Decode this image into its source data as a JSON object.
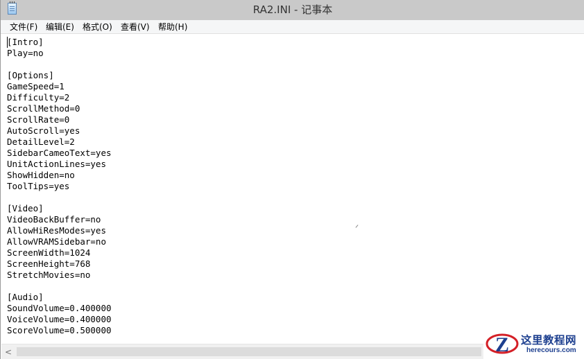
{
  "window": {
    "title": "RA2.INI - 记事本"
  },
  "menubar": {
    "items": [
      {
        "label": "文件(F)"
      },
      {
        "label": "编辑(E)"
      },
      {
        "label": "格式(O)"
      },
      {
        "label": "查看(V)"
      },
      {
        "label": "帮助(H)"
      }
    ]
  },
  "editor": {
    "content": "[Intro]\nPlay=no\n\n[Options]\nGameSpeed=1\nDifficulty=2\nScrollMethod=0\nScrollRate=0\nAutoScroll=yes\nDetailLevel=2\nSidebarCameoText=yes\nUnitActionLines=yes\nShowHidden=no\nToolTips=yes\n\n[Video]\nVideoBackBuffer=no\nAllowHiResModes=yes\nAllowVRAMSidebar=no\nScreenWidth=1024\nScreenHeight=768\nStretchMovies=no\n\n[Audio]\nSoundVolume=0.400000\nVoiceVolume=0.400000\nScoreVolume=0.500000"
  },
  "scrollbar": {
    "left_arrow": "<"
  },
  "watermark": {
    "cn_text": "这里教程网",
    "en_text": "herecours.com",
    "logo_letter": "Z"
  },
  "colors": {
    "titlebar": "#c9c9c9",
    "menubar": "#f5f6f7",
    "text": "#000000",
    "watermark_blue": "#1d3f8f",
    "watermark_red": "#d42027"
  },
  "icons": {
    "app": "notepad-icon",
    "logo": "z-logo-icon"
  }
}
